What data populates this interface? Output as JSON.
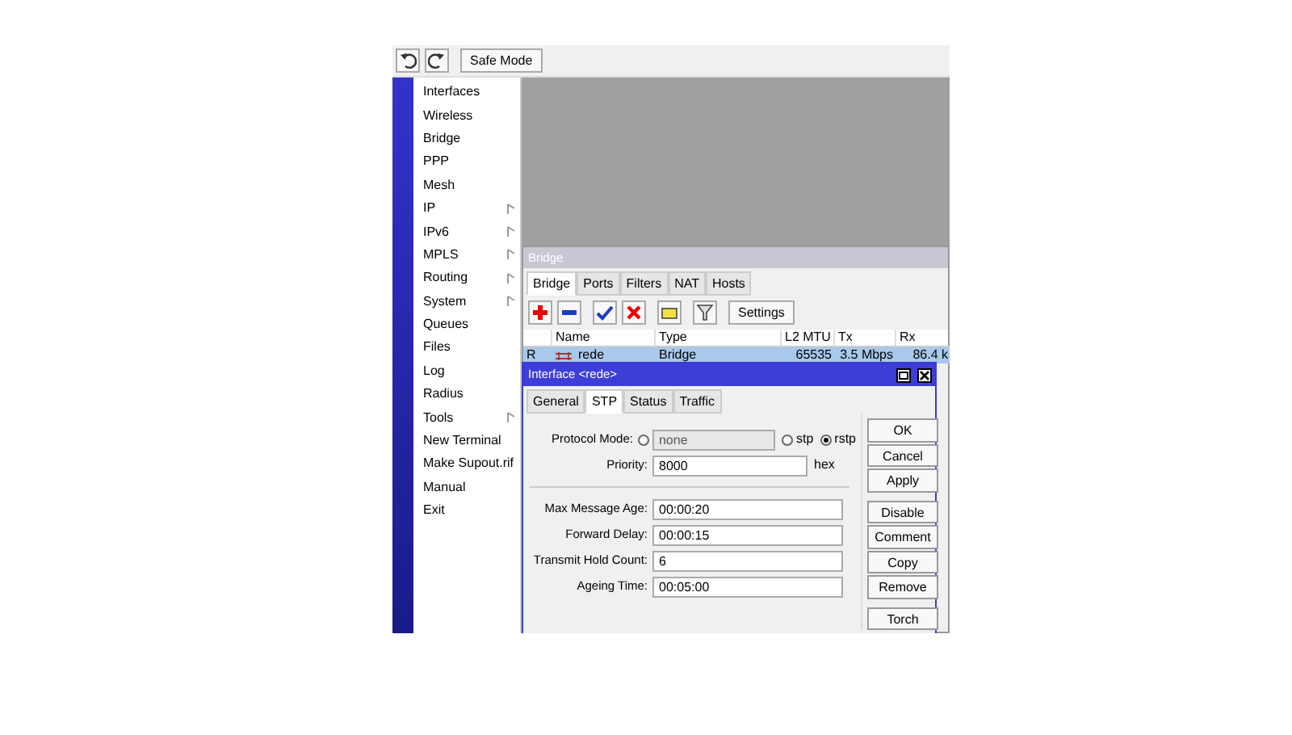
{
  "toolbar": {
    "buttons": [
      {
        "kind": "undo"
      },
      {
        "kind": "redo"
      }
    ],
    "safe_mode": "Safe Mode"
  },
  "menu": [
    {
      "label": "Interfaces",
      "submenu": false
    },
    {
      "label": "Wireless",
      "submenu": false
    },
    {
      "label": "Bridge",
      "submenu": false
    },
    {
      "label": "PPP",
      "submenu": false
    },
    {
      "label": "Mesh",
      "submenu": false
    },
    {
      "label": "IP",
      "submenu": true
    },
    {
      "label": "IPv6",
      "submenu": true
    },
    {
      "label": "MPLS",
      "submenu": true
    },
    {
      "label": "Routing",
      "submenu": true
    },
    {
      "label": "System",
      "submenu": true
    },
    {
      "label": "Queues",
      "submenu": false
    },
    {
      "label": "Files",
      "submenu": false
    },
    {
      "label": "Log",
      "submenu": false
    },
    {
      "label": "Radius",
      "submenu": false
    },
    {
      "label": "Tools",
      "submenu": true
    },
    {
      "label": "New Terminal",
      "submenu": false
    },
    {
      "label": "Make Supout.rif",
      "submenu": false
    },
    {
      "label": "Manual",
      "submenu": false
    },
    {
      "label": "Exit",
      "submenu": false
    }
  ],
  "bridge_window": {
    "title": "Bridge",
    "tabs": [
      {
        "label": "Bridge",
        "selected": true
      },
      {
        "label": "Ports",
        "selected": false
      },
      {
        "label": "Filters",
        "selected": false
      },
      {
        "label": "NAT",
        "selected": false
      },
      {
        "label": "Hosts",
        "selected": false
      }
    ],
    "tools": [
      {
        "kind": "add"
      },
      {
        "kind": "remove"
      },
      {
        "kind": "enable"
      },
      {
        "kind": "disable"
      },
      {
        "kind": "comment"
      },
      {
        "kind": "filter"
      }
    ],
    "settings": "Settings",
    "table": {
      "columns": [
        "Name",
        "Type",
        "L2 MTU",
        "Tx",
        "Rx"
      ],
      "rows": [
        {
          "flag": "R",
          "name": "rede",
          "type": "Bridge",
          "l2_mtu": "65535",
          "tx": "3.5 Mbps",
          "rx": "86.4 k",
          "selected": true
        }
      ]
    }
  },
  "dialog": {
    "title": "Interface <rede>",
    "tabs": [
      {
        "label": "General",
        "selected": false
      },
      {
        "label": "STP",
        "selected": true
      },
      {
        "label": "Status",
        "selected": false
      },
      {
        "label": "Traffic",
        "selected": false
      }
    ],
    "protocol_mode": {
      "label": "Protocol Mode:",
      "options": [
        {
          "label": "none",
          "selected": false
        },
        {
          "label": "stp",
          "selected": false
        },
        {
          "label": "rstp",
          "selected": true
        }
      ]
    },
    "priority": {
      "label": "Priority:",
      "value": "8000",
      "unit": "hex"
    },
    "fields": [
      {
        "label": "Max Message Age:",
        "value": "00:00:20"
      },
      {
        "label": "Forward Delay:",
        "value": "00:00:15"
      },
      {
        "label": "Transmit Hold Count:",
        "value": "6"
      },
      {
        "label": "Ageing Time:",
        "value": "00:05:00"
      }
    ],
    "button_groups": [
      [
        "OK",
        "Cancel",
        "Apply"
      ],
      [
        "Disable",
        "Comment",
        "Copy",
        "Remove"
      ],
      [
        "Torch"
      ]
    ]
  }
}
